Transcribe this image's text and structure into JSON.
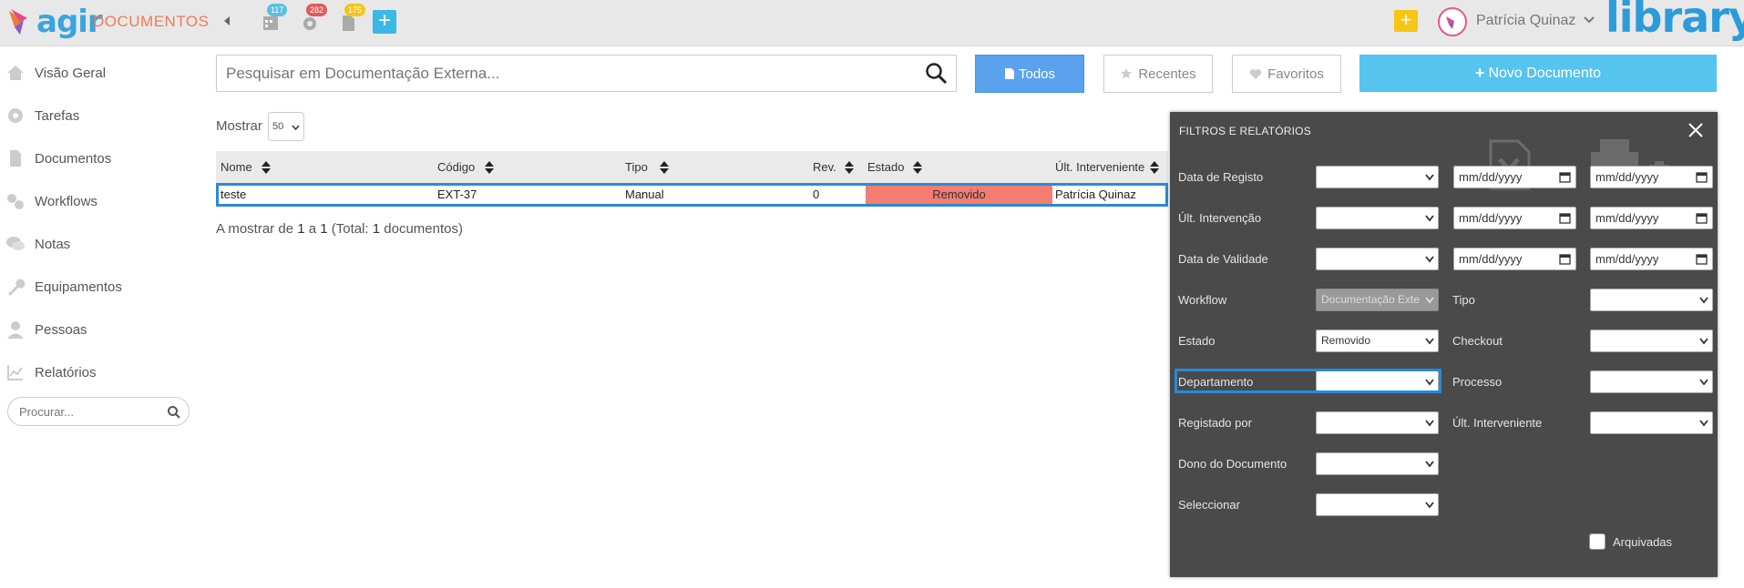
{
  "header": {
    "logo_text": "agir",
    "module_title": "DOCUMENTOS",
    "badges": [
      {
        "icon": "calendar-icon",
        "count": "117",
        "color": "#5bc0de"
      },
      {
        "icon": "gear-alert-icon",
        "count": "282",
        "color": "#e05a5a"
      },
      {
        "icon": "document-icon",
        "count": "175",
        "color": "#f5c518"
      }
    ],
    "user_name": "Patrícia Quinaz",
    "brand": "library"
  },
  "sidebar": {
    "items": [
      {
        "label": "Visão Geral",
        "icon": "home-icon"
      },
      {
        "label": "Tarefas",
        "icon": "gear-icon"
      },
      {
        "label": "Documentos",
        "icon": "document-icon"
      },
      {
        "label": "Workflows",
        "icon": "gears-icon"
      },
      {
        "label": "Notas",
        "icon": "chat-icon"
      },
      {
        "label": "Equipamentos",
        "icon": "wrench-icon"
      },
      {
        "label": "Pessoas",
        "icon": "person-icon"
      },
      {
        "label": "Relatórios",
        "icon": "chart-icon"
      }
    ],
    "search_placeholder": "Procurar..."
  },
  "main": {
    "search_placeholder": "Pesquisar em Documentação Externa...",
    "tabs": [
      {
        "label": "Todos",
        "icon": "file-icon",
        "active": true
      },
      {
        "label": "Recentes",
        "icon": "star-icon",
        "active": false
      },
      {
        "label": "Favoritos",
        "icon": "heart-icon",
        "active": false
      }
    ],
    "new_button": "Novo Documento",
    "show_label": "Mostrar",
    "show_value": "50",
    "columns": [
      "Nome",
      "Código",
      "Tipo",
      "Rev.",
      "Estado",
      "Últ. Interveniente"
    ],
    "rows": [
      {
        "nome": "teste",
        "codigo": "EXT-37",
        "tipo": "Manual",
        "rev": "0",
        "estado": "Removido",
        "ult": "Patrícia Quinaz"
      }
    ],
    "summary_prefix": "A mostrar de ",
    "summary_from": "1",
    "summary_mid": " a ",
    "summary_to": "1",
    "summary_total_prefix": " (Total: ",
    "summary_total": "1",
    "summary_suffix": " documentos)"
  },
  "filters": {
    "title": "FILTROS E RELATÓRIOS",
    "date_placeholder": "mm/dd/yyyy",
    "labels": {
      "data_registo": "Data de Registo",
      "ult_intervencao": "Últ. Intervenção",
      "data_validade": "Data de Validade",
      "workflow": "Workflow",
      "tipo": "Tipo",
      "estado": "Estado",
      "checkout": "Checkout",
      "departamento": "Departamento",
      "processo": "Processo",
      "registado_por": "Registado por",
      "ult_interveniente": "Últ. Interveniente",
      "dono": "Dono do Documento",
      "seleccionar": "Seleccionar",
      "arquivadas": "Arquivadas"
    },
    "workflow_value": "Documentação Exte",
    "estado_value": "Removido"
  }
}
